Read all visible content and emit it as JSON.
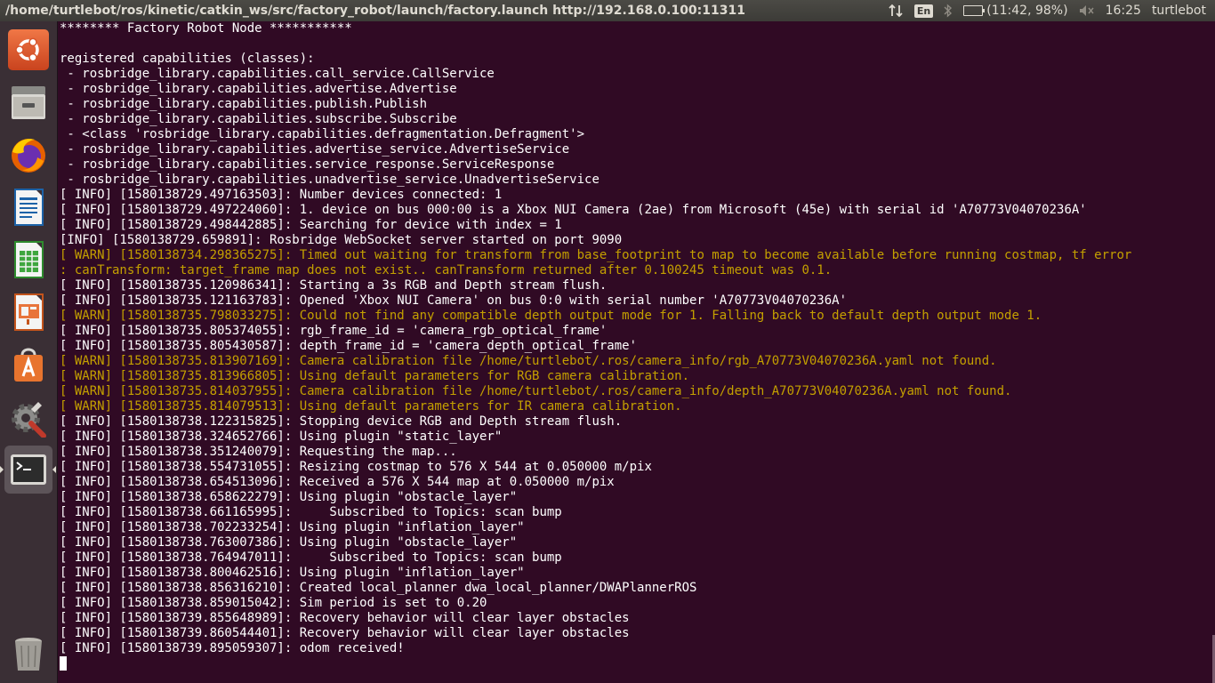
{
  "window": {
    "title": "/home/turtlebot/ros/kinetic/catkin_ws/src/factory_robot/launch/factory.launch http://192.168.0.100:11311"
  },
  "indicators": {
    "network_icon": "network-transfer-icon",
    "language": "En",
    "bluetooth_icon": "bluetooth-icon",
    "battery_text": "(11:42, 98%)",
    "battery_level": 0.98,
    "volume_icon": "volume-muted-icon",
    "clock": "16:25",
    "user": "turtlebot",
    "power_icon": "gear-power-icon"
  },
  "launcher": [
    {
      "name": "ubuntu-dash",
      "icon": "ubuntu-logo-icon"
    },
    {
      "name": "files",
      "icon": "file-cabinet-icon"
    },
    {
      "name": "firefox",
      "icon": "firefox-icon"
    },
    {
      "name": "libreoffice-writer",
      "icon": "writer-document-icon"
    },
    {
      "name": "libreoffice-calc",
      "icon": "calc-spreadsheet-icon"
    },
    {
      "name": "libreoffice-impress",
      "icon": "impress-presentation-icon"
    },
    {
      "name": "software-center",
      "icon": "shopping-bag-icon"
    },
    {
      "name": "system-settings",
      "icon": "settings-gear-wrench-icon"
    },
    {
      "name": "terminal",
      "icon": "terminal-icon"
    },
    {
      "name": "trash",
      "icon": "trash-icon"
    }
  ],
  "colors": {
    "terminal_bg": "#300a24",
    "text": "#ffffff",
    "warn": "#c4a000",
    "launcher_bg": "#3a2f35",
    "topbar_bg": "#3c3b37"
  },
  "terminal": {
    "lines": [
      {
        "text": "******** Factory Robot Node ***********",
        "level": "plain"
      },
      {
        "text": "",
        "level": "plain"
      },
      {
        "text": "registered capabilities (classes):",
        "level": "plain"
      },
      {
        "text": " - rosbridge_library.capabilities.call_service.CallService",
        "level": "plain"
      },
      {
        "text": " - rosbridge_library.capabilities.advertise.Advertise",
        "level": "plain"
      },
      {
        "text": " - rosbridge_library.capabilities.publish.Publish",
        "level": "plain"
      },
      {
        "text": " - rosbridge_library.capabilities.subscribe.Subscribe",
        "level": "plain"
      },
      {
        "text": " - <class 'rosbridge_library.capabilities.defragmentation.Defragment'>",
        "level": "plain"
      },
      {
        "text": " - rosbridge_library.capabilities.advertise_service.AdvertiseService",
        "level": "plain"
      },
      {
        "text": " - rosbridge_library.capabilities.service_response.ServiceResponse",
        "level": "plain"
      },
      {
        "text": " - rosbridge_library.capabilities.unadvertise_service.UnadvertiseService",
        "level": "plain"
      },
      {
        "text": "[ INFO] [1580138729.497163503]: Number devices connected: 1",
        "level": "info"
      },
      {
        "text": "[ INFO] [1580138729.497224060]: 1. device on bus 000:00 is a Xbox NUI Camera (2ae) from Microsoft (45e) with serial id 'A70773V04070236A'",
        "level": "info"
      },
      {
        "text": "[ INFO] [1580138729.498442885]: Searching for device with index = 1",
        "level": "info"
      },
      {
        "text": "[INFO] [1580138729.659891]: Rosbridge WebSocket server started on port 9090",
        "level": "info"
      },
      {
        "text": "[ WARN] [1580138734.298365275]: Timed out waiting for transform from base_footprint to map to become available before running costmap, tf error",
        "level": "warn"
      },
      {
        "text": ": canTransform: target_frame map does not exist.. canTransform returned after 0.100245 timeout was 0.1.",
        "level": "warn"
      },
      {
        "text": "[ INFO] [1580138735.120986341]: Starting a 3s RGB and Depth stream flush.",
        "level": "info"
      },
      {
        "text": "[ INFO] [1580138735.121163783]: Opened 'Xbox NUI Camera' on bus 0:0 with serial number 'A70773V04070236A'",
        "level": "info"
      },
      {
        "text": "[ WARN] [1580138735.798033275]: Could not find any compatible depth output mode for 1. Falling back to default depth output mode 1.",
        "level": "warn"
      },
      {
        "text": "[ INFO] [1580138735.805374055]: rgb_frame_id = 'camera_rgb_optical_frame'",
        "level": "info"
      },
      {
        "text": "[ INFO] [1580138735.805430587]: depth_frame_id = 'camera_depth_optical_frame'",
        "level": "info"
      },
      {
        "text": "[ WARN] [1580138735.813907169]: Camera calibration file /home/turtlebot/.ros/camera_info/rgb_A70773V04070236A.yaml not found.",
        "level": "warn"
      },
      {
        "text": "[ WARN] [1580138735.813966805]: Using default parameters for RGB camera calibration.",
        "level": "warn"
      },
      {
        "text": "[ WARN] [1580138735.814037955]: Camera calibration file /home/turtlebot/.ros/camera_info/depth_A70773V04070236A.yaml not found.",
        "level": "warn"
      },
      {
        "text": "[ WARN] [1580138735.814079513]: Using default parameters for IR camera calibration.",
        "level": "warn"
      },
      {
        "text": "[ INFO] [1580138738.122315825]: Stopping device RGB and Depth stream flush.",
        "level": "info"
      },
      {
        "text": "[ INFO] [1580138738.324652766]: Using plugin \"static_layer\"",
        "level": "info"
      },
      {
        "text": "[ INFO] [1580138738.351240079]: Requesting the map...",
        "level": "info"
      },
      {
        "text": "[ INFO] [1580138738.554731055]: Resizing costmap to 576 X 544 at 0.050000 m/pix",
        "level": "info"
      },
      {
        "text": "[ INFO] [1580138738.654513096]: Received a 576 X 544 map at 0.050000 m/pix",
        "level": "info"
      },
      {
        "text": "[ INFO] [1580138738.658622279]: Using plugin \"obstacle_layer\"",
        "level": "info"
      },
      {
        "text": "[ INFO] [1580138738.661165995]:     Subscribed to Topics: scan bump",
        "level": "info"
      },
      {
        "text": "[ INFO] [1580138738.702233254]: Using plugin \"inflation_layer\"",
        "level": "info"
      },
      {
        "text": "[ INFO] [1580138738.763007386]: Using plugin \"obstacle_layer\"",
        "level": "info"
      },
      {
        "text": "[ INFO] [1580138738.764947011]:     Subscribed to Topics: scan bump",
        "level": "info"
      },
      {
        "text": "[ INFO] [1580138738.800462516]: Using plugin \"inflation_layer\"",
        "level": "info"
      },
      {
        "text": "[ INFO] [1580138738.856316210]: Created local_planner dwa_local_planner/DWAPlannerROS",
        "level": "info"
      },
      {
        "text": "[ INFO] [1580138738.859015042]: Sim period is set to 0.20",
        "level": "info"
      },
      {
        "text": "[ INFO] [1580138739.855648989]: Recovery behavior will clear layer obstacles",
        "level": "info"
      },
      {
        "text": "[ INFO] [1580138739.860544401]: Recovery behavior will clear layer obstacles",
        "level": "info"
      },
      {
        "text": "[ INFO] [1580138739.895059307]: odom received!",
        "level": "info"
      },
      {
        "text": "",
        "level": "cursor"
      }
    ]
  }
}
